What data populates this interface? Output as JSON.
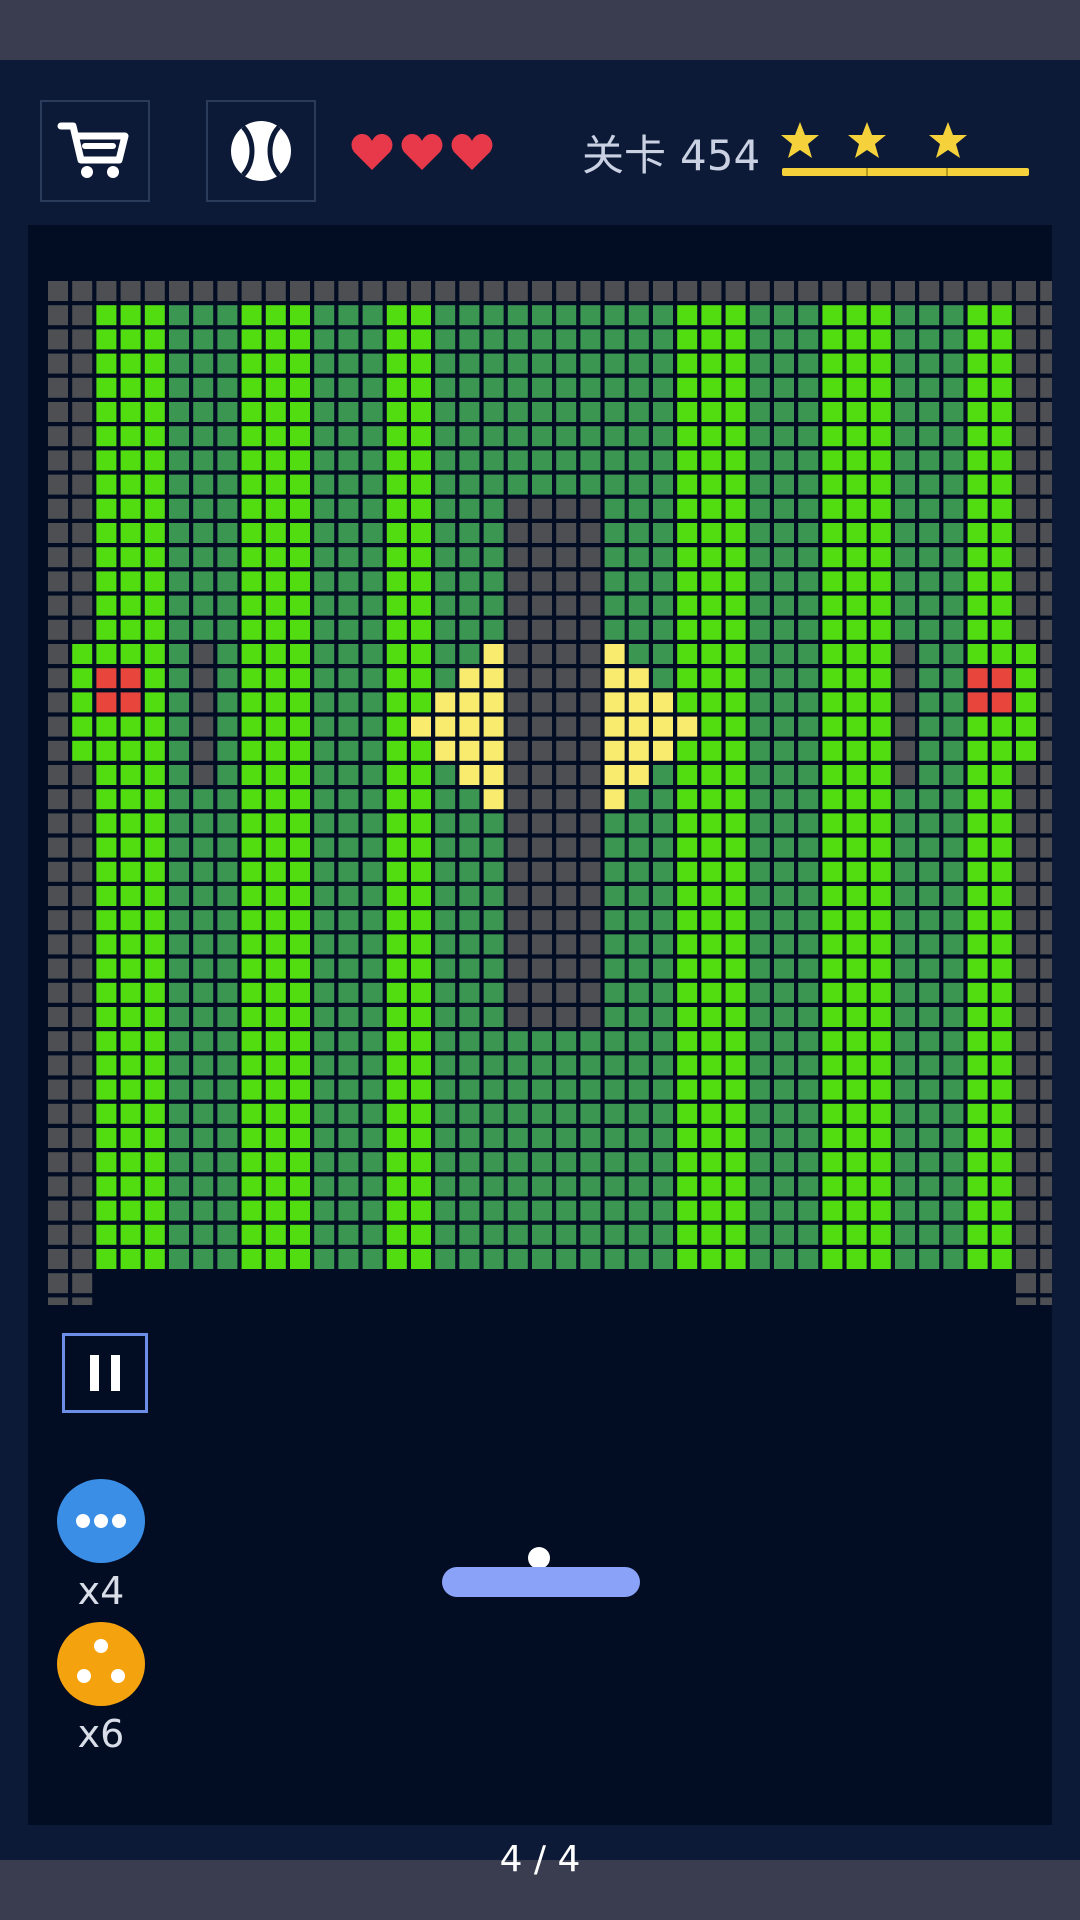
{
  "header": {
    "shop_icon": "cart-icon",
    "ball_select_icon": "baseball-icon",
    "lives": 3,
    "level_label": "关卡",
    "level_number": "454",
    "stars_earned": 3,
    "star_color": "#f5d23c"
  },
  "board": {
    "colors": {
      "bright_green": "#52dd10",
      "dark_green": "#3b9651",
      "gray": "#4d4f52",
      "yellow": "#f9eb6e",
      "red": "#e8453c"
    }
  },
  "controls": {
    "pause_icon": "pause-icon"
  },
  "powerups": [
    {
      "icon": "multiball-icon",
      "color": "#3a8ee6",
      "count": "x4"
    },
    {
      "icon": "split-ball-icon",
      "color": "#f5a20f",
      "count": "x6"
    }
  ],
  "footer": {
    "page_indicator": "4 / 4"
  }
}
